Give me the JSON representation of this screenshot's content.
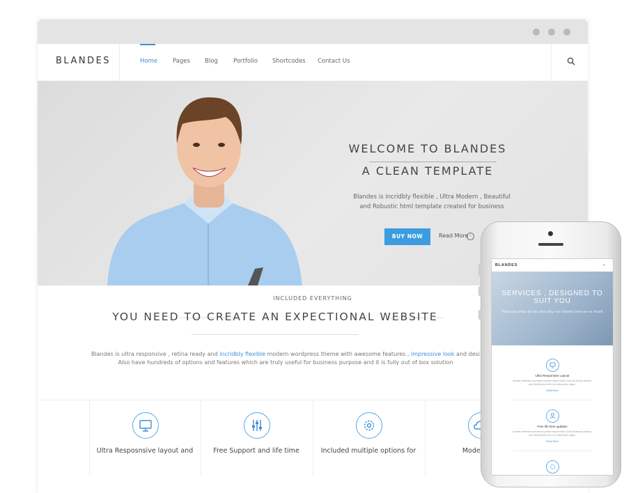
{
  "brand": {
    "logo": "BLANDES",
    "accent": "#3b8fd9",
    "button_color": "#3b9de0"
  },
  "nav": {
    "items": [
      {
        "label": "Home",
        "active": true
      },
      {
        "label": "Pages"
      },
      {
        "label": "Blog"
      },
      {
        "label": "Portfolio"
      },
      {
        "label": "Shortcodes"
      },
      {
        "label": "Contact Us"
      }
    ],
    "search_icon": "search-icon"
  },
  "hero": {
    "title": "WELCOME TO BLANDES",
    "subtitle": "A CLEAN TEMPLATE",
    "text_line1": "Blandes is incridbly flexible , Ultra Modern , Beautiful",
    "text_line2": "and Robustic html template created for business",
    "buy_label": "BUY NOW",
    "read_more_label": "Read More"
  },
  "section": {
    "eyebrow": "INCLUDED EVERYTHING",
    "title": "YOU NEED TO CREATE AN EXPECTIONAL WEBSITE",
    "text_part1": "Blandes is ultra responsive , retina ready and ",
    "text_hl1": "incridbly flexible",
    "text_part2": "  modern wordpress theme with awesome features , ",
    "text_hl2": "impressive look",
    "text_part3": "  and desi",
    "text_line2": "Also have hundreds of options and features which are truly useful for business purpose and it is fully out of box solution"
  },
  "features": [
    {
      "label": "Ultra Resposnsive layout and",
      "icon": "monitor-icon"
    },
    {
      "label": "Free Support and life time",
      "icon": "sliders-icon"
    },
    {
      "label": "Included multiple options for",
      "icon": "gear-icon"
    },
    {
      "label": "Modern cle",
      "icon": "cloud-icon"
    }
  ],
  "mobile": {
    "logo": "BLANDES",
    "menu_icon": "menu-icon",
    "hero_title": "SERVICES , DESIGNED TO SUIT YOU",
    "hero_sub": "Find out what we do and why our clients love us so much",
    "features": [
      {
        "title": "Ultra Responsive Layout",
        "text": "Aenean fermentum accumsan a potenti neque massa. Duis nisl tempus pulvinar, arcu blandit purus nibh, non ullamcorper augue.",
        "link": "Read More",
        "icon": "monitor-icon"
      },
      {
        "title": "Free life time updates",
        "text": "Aenean fermentum accumsan a potenti neque massa. Duis nisl tempus pulvinar, arcu blandit purus nibh, non ullamcorper augue.",
        "link": "Read More",
        "icon": "user-icon"
      },
      {
        "title": "",
        "text": "",
        "link": "",
        "icon": "gear-icon"
      }
    ]
  }
}
